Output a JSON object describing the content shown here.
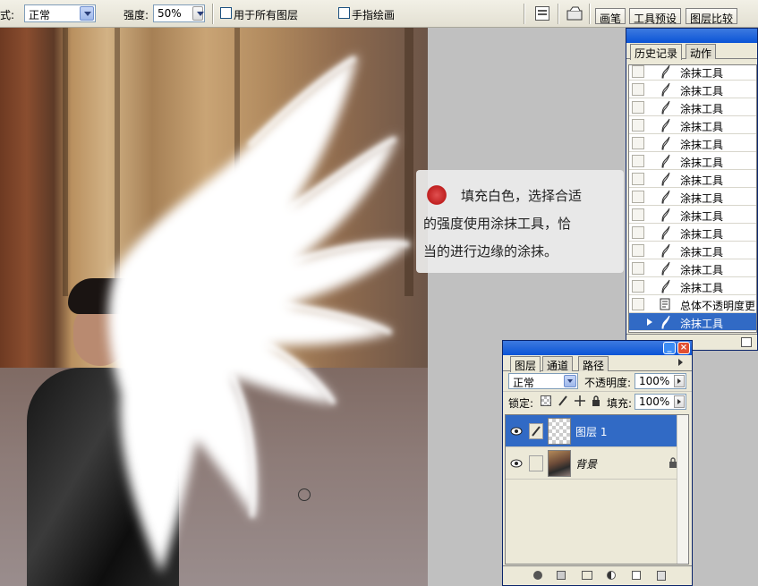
{
  "options_bar": {
    "mode_label": "式:",
    "mode_value": "正常",
    "strength_label": "强度:",
    "strength_value": "50%",
    "sample_all_layers_label": "用于所有图层",
    "finger_painting_label": "手指绘画",
    "panel_tabs": [
      "画笔",
      "工具预设",
      "图层比较"
    ]
  },
  "annotation": {
    "lines": [
      "填充白色，选择合适",
      "的强度使用涂抹工具，恰",
      "当的进行边缘的涂抹。"
    ]
  },
  "history_panel": {
    "tabs": [
      "历史记录",
      "动作"
    ],
    "items": [
      {
        "label": "涂抹工具",
        "icon": "smudge-tool-icon",
        "selected": false
      },
      {
        "label": "涂抹工具",
        "icon": "smudge-tool-icon",
        "selected": false
      },
      {
        "label": "涂抹工具",
        "icon": "smudge-tool-icon",
        "selected": false
      },
      {
        "label": "涂抹工具",
        "icon": "smudge-tool-icon",
        "selected": false
      },
      {
        "label": "涂抹工具",
        "icon": "smudge-tool-icon",
        "selected": false
      },
      {
        "label": "涂抹工具",
        "icon": "smudge-tool-icon",
        "selected": false
      },
      {
        "label": "涂抹工具",
        "icon": "smudge-tool-icon",
        "selected": false
      },
      {
        "label": "涂抹工具",
        "icon": "smudge-tool-icon",
        "selected": false
      },
      {
        "label": "涂抹工具",
        "icon": "smudge-tool-icon",
        "selected": false
      },
      {
        "label": "涂抹工具",
        "icon": "smudge-tool-icon",
        "selected": false
      },
      {
        "label": "涂抹工具",
        "icon": "smudge-tool-icon",
        "selected": false
      },
      {
        "label": "涂抹工具",
        "icon": "smudge-tool-icon",
        "selected": false
      },
      {
        "label": "涂抹工具",
        "icon": "smudge-tool-icon",
        "selected": false
      },
      {
        "label": "总体不透明度更改",
        "icon": "document-icon",
        "selected": false
      },
      {
        "label": "涂抹工具",
        "icon": "smudge-tool-icon",
        "selected": true
      }
    ]
  },
  "layers_panel": {
    "tabs": [
      "图层",
      "通道",
      "路径"
    ],
    "blend_mode": "正常",
    "opacity_label": "不透明度:",
    "opacity_value": "100%",
    "lock_label": "锁定:",
    "fill_label": "填充:",
    "fill_value": "100%",
    "layers": [
      {
        "name": "图层 1",
        "selected": true
      },
      {
        "name": "背景",
        "selected": false
      }
    ]
  },
  "colors": {
    "selection_blue": "#316ac5",
    "panel_bg": "#ece9d8",
    "titlebar_blue": "#0b54d6"
  }
}
